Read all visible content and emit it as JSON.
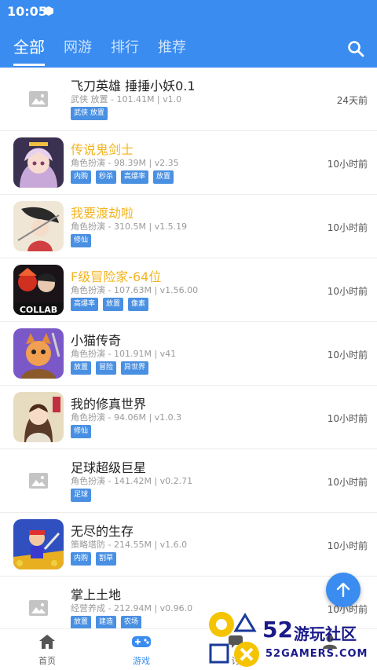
{
  "status_bar": {
    "time": "10:05"
  },
  "tabs": [
    {
      "label": "全部"
    },
    {
      "label": "网游"
    },
    {
      "label": "排行"
    },
    {
      "label": "推荐"
    }
  ],
  "games": [
    {
      "title": "飞刀英雄 捶捶小妖0.1",
      "meta": "武侠 放置 - 101.41M | v1.0",
      "tags": [
        "武侠 放置"
      ],
      "time": "24天前",
      "icon": "placeholder-image-icon",
      "highlight": false
    },
    {
      "title": "传说鬼剑士",
      "meta": "角色扮演 - 98.39M | v2.35",
      "tags": [
        "内购",
        "秒杀",
        "高爆率",
        "放置"
      ],
      "time": "10小时前",
      "icon": "anime-girl-icon",
      "highlight": true
    },
    {
      "title": "我要渡劫啦",
      "meta": "角色扮演 - 310.5M | v1.5.19",
      "tags": [
        "修仙"
      ],
      "time": "10小时前",
      "icon": "ink-warrior-icon",
      "highlight": true
    },
    {
      "title": "F级冒险家-64位",
      "meta": "角色扮演 - 107.63M | v1.56.00",
      "tags": [
        "高爆率",
        "放置",
        "像素"
      ],
      "time": "10小时前",
      "icon": "collab-icon",
      "highlight": true
    },
    {
      "title": "小猫传奇",
      "meta": "角色扮演 - 101.91M | v41",
      "tags": [
        "放置",
        "冒险",
        "异世界"
      ],
      "time": "10小时前",
      "icon": "cat-hero-icon",
      "highlight": false
    },
    {
      "title": "我的修真世界",
      "meta": "角色扮演 - 94.06M | v1.0.3",
      "tags": [
        "修仙"
      ],
      "time": "10小时前",
      "icon": "cultivator-icon",
      "highlight": false
    },
    {
      "title": "足球超级巨星",
      "meta": "角色扮演 - 141.42M | v0.2.71",
      "tags": [
        "足球"
      ],
      "time": "10小时前",
      "icon": "placeholder-image-icon",
      "highlight": false
    },
    {
      "title": "无尽的生存",
      "meta": "策略塔防 - 214.55M | v1.6.0",
      "tags": [
        "内购",
        "割草"
      ],
      "time": "10小时前",
      "icon": "survivor-icon",
      "highlight": false
    },
    {
      "title": "掌上土地",
      "meta": "经营养成 - 212.94M | v0.96.0",
      "tags": [
        "放置",
        "建造",
        "农场"
      ],
      "time": "10小时前",
      "icon": "placeholder-image-icon",
      "highlight": false
    }
  ],
  "bottom_nav": [
    {
      "label": "首页",
      "icon": "home-icon"
    },
    {
      "label": "游戏",
      "icon": "gamepad-icon"
    },
    {
      "label": "讨",
      "icon": "chat-icon"
    },
    {
      "label": "",
      "icon": "profile-icon"
    }
  ],
  "watermark": {
    "number": "52",
    "title": "游玩社区",
    "subtitle": "52GAMERS.COM"
  },
  "colors": {
    "primary": "#3a8cf0",
    "highlight": "#f2b420",
    "tag": "#4a90e2"
  }
}
